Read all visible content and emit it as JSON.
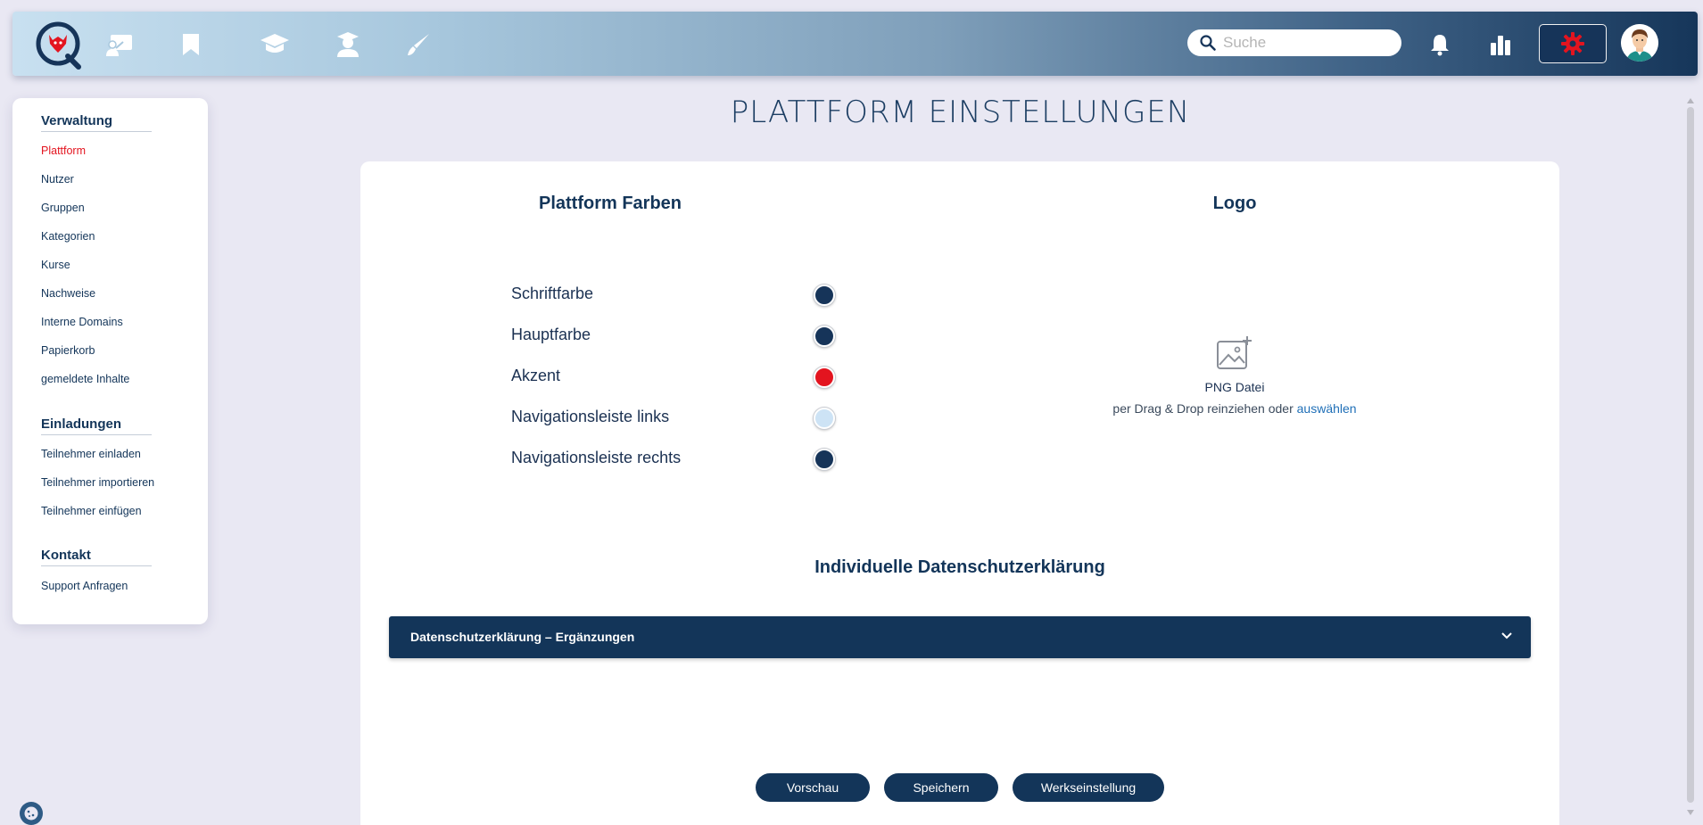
{
  "topbar": {
    "nav_icons": [
      "presentation-icon",
      "bookmark-icon",
      "graduation-cap-icon",
      "teacher-icon",
      "pen-icon"
    ],
    "search": {
      "placeholder": "Suche",
      "value": ""
    },
    "accent_color": "#e3141f",
    "gradient": [
      "#c8e0f0",
      "#16365a"
    ]
  },
  "sidebar": {
    "sections": [
      {
        "heading": "Verwaltung",
        "items": [
          "Plattform",
          "Nutzer",
          "Gruppen",
          "Kategorien",
          "Kurse",
          "Nachweise",
          "Interne Domains",
          "Papierkorb",
          "gemeldete Inhalte"
        ]
      },
      {
        "heading": "Einladungen",
        "items": [
          "Teilnehmer einladen",
          "Teilnehmer importieren",
          "Teilnehmer einfügen"
        ]
      },
      {
        "heading": "Kontakt",
        "items": [
          "Support Anfragen"
        ]
      }
    ],
    "active_item": "Plattform"
  },
  "page": {
    "title": "PLATTFORM EINSTELLUNGEN"
  },
  "colors": {
    "title": "Plattform Farben",
    "items": [
      {
        "label": "Schriftfarbe",
        "color": "#163459"
      },
      {
        "label": "Hauptfarbe",
        "color": "#163459"
      },
      {
        "label": "Akzent",
        "color": "#e3141f"
      },
      {
        "label": "Navigationsleiste links",
        "color": "#cde3f5"
      },
      {
        "label": "Navigationsleiste rechts",
        "color": "#163459"
      }
    ]
  },
  "logo": {
    "title": "Logo",
    "file_type": "PNG Datei",
    "hint": "per Drag & Drop reinziehen oder ",
    "pick_link": "auswählen"
  },
  "privacy": {
    "title": "Individuelle Datenschutzerklärung",
    "accordion_label": "Datenschutzerklärung – Ergänzungen"
  },
  "actions": {
    "preview": "Vorschau",
    "save": "Speichern",
    "reset": "Werkseinstellung"
  }
}
